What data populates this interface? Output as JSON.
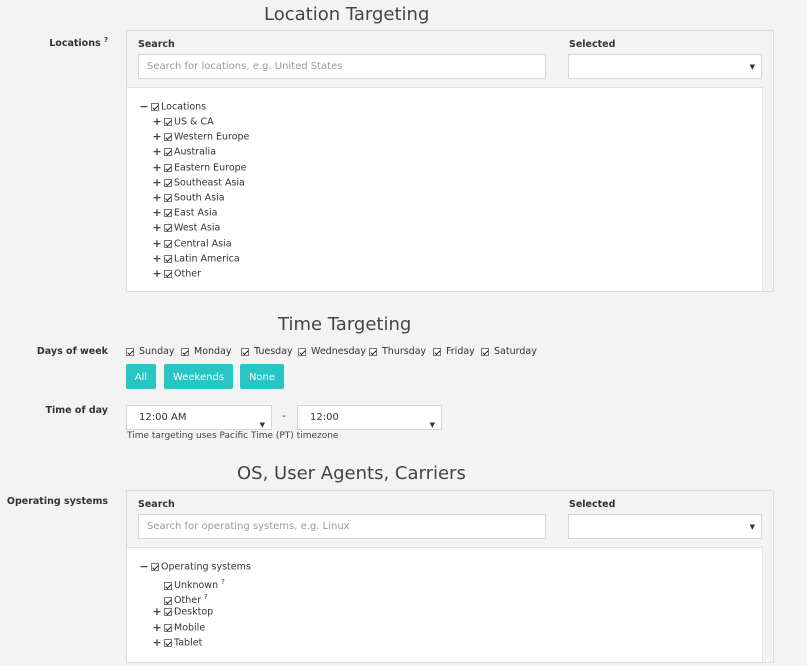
{
  "location": {
    "title": "Location Targeting",
    "label": "Locations",
    "help": "?",
    "search_header": "Search",
    "selected_header": "Selected",
    "search_placeholder": "Search for locations, e.g. United States",
    "selected_value": "",
    "root": "Locations",
    "items": [
      "US & CA",
      "Western Europe",
      "Australia",
      "Eastern Europe",
      "Southeast Asia",
      "South Asia",
      "East Asia",
      "West Asia",
      "Central Asia",
      "Latin America",
      "Other"
    ]
  },
  "time": {
    "title": "Time Targeting",
    "days_label": "Days of week",
    "days": [
      "Sunday",
      "Monday",
      "Tuesday",
      "Wednesday",
      "Thursday",
      "Friday",
      "Saturday"
    ],
    "buttons": {
      "all": "All",
      "weekends": "Weekends",
      "none": "None"
    },
    "time_label": "Time of day",
    "start_time": "12:00 AM",
    "end_time": "12:00",
    "separator": "-",
    "timezone_note": "Time targeting uses Pacific Time (PT) timezone"
  },
  "os": {
    "title": "OS, User Agents, Carriers",
    "label": "Operating systems",
    "search_header": "Search",
    "selected_header": "Selected",
    "search_placeholder": "Search for operating systems, e.g. Linux",
    "selected_value": "",
    "root": "Operating systems",
    "items": [
      {
        "label": "Unknown",
        "help": "?"
      },
      {
        "label": "Other",
        "help": "?"
      },
      {
        "label": "Desktop",
        "help": ""
      },
      {
        "label": "Mobile",
        "help": ""
      },
      {
        "label": "Tablet",
        "help": ""
      }
    ]
  },
  "icons": {
    "expand": "plus-icon",
    "collapse": "minus-icon",
    "checkbox": "checkbox-checked-icon",
    "dropdown": "caret-down-icon"
  }
}
